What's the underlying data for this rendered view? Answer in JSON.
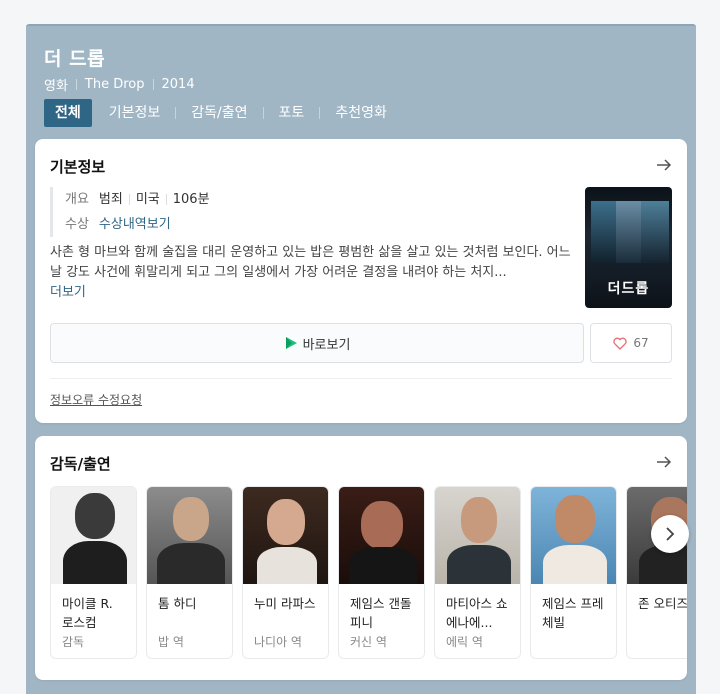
{
  "movie": {
    "title": "더 드롭",
    "genre": "영화",
    "original_title": "The Drop",
    "year": "2014"
  },
  "tabs": [
    {
      "label": "전체",
      "active": true
    },
    {
      "label": "기본정보"
    },
    {
      "label": "감독/출연"
    },
    {
      "label": "포토"
    },
    {
      "label": "추천영화"
    }
  ],
  "basic_info": {
    "title": "기본정보",
    "overview_label": "개요",
    "overview": [
      "범죄",
      "미국",
      "106분"
    ],
    "award_label": "수상",
    "award_link": "수상내역보기",
    "synopsis": "사촌 형 마브와 함께 술집을 대리 운영하고 있는 밥은 평범한 삶을 살고 있는 것처럼 보인다. 어느 날 강도 사건에 휘말리게 되고 그의 일생에서 가장 어려운 결정을 내려야 하는 처지...",
    "more": "더보기",
    "poster_title": "더드롭",
    "watch_label": "바로보기",
    "like_count": "67",
    "report_label": "정보오류 수정요청"
  },
  "cast_section": {
    "title": "감독/출연",
    "people": [
      {
        "name": "마이클 R. 로스컴",
        "role": "감독"
      },
      {
        "name": "톰 하디",
        "role": "밥 역"
      },
      {
        "name": "누미 라파스",
        "role": "나디아 역"
      },
      {
        "name": "제임스 갠돌피니",
        "role": "커신 역"
      },
      {
        "name": "마티아스 쇼에나에...",
        "role": "에릭 역"
      },
      {
        "name": "제임스 프레체빌",
        "role": ""
      },
      {
        "name": "존 오티즈",
        "role": ""
      }
    ]
  },
  "colors": {
    "panel_bg": "#a1b6c5",
    "active_tab": "#2f6585",
    "link": "#2f6585",
    "play_icon": "#19c37d",
    "heart": "#e5737a"
  },
  "icons": {
    "arrow": "arrow-right-icon",
    "play": "play-icon",
    "heart": "heart-icon",
    "next": "chevron-right-icon"
  }
}
